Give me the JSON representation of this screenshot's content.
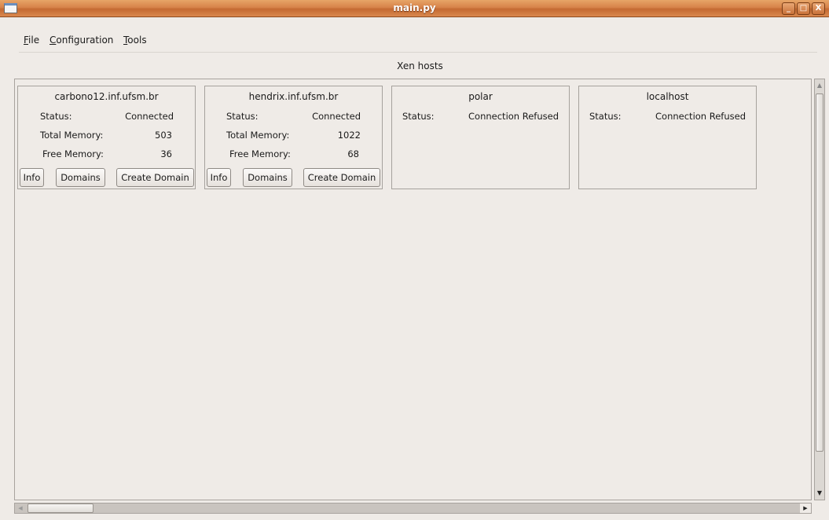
{
  "window": {
    "title": "main.py",
    "controls": {
      "minimize": "_",
      "maximize": "□",
      "close": "X"
    }
  },
  "menu": {
    "file": {
      "mnemonic": "F",
      "rest": "ile"
    },
    "configuration": {
      "mnemonic": "C",
      "rest": "onfiguration"
    },
    "tools": {
      "mnemonic": "T",
      "rest": "ools"
    }
  },
  "section_label": "Xen hosts",
  "hosts": [
    {
      "name": "carbono12.inf.ufsm.br",
      "status_label": "Status:",
      "status": "Connected",
      "total_label": "Total Memory:",
      "total": "503",
      "free_label": "Free Memory:",
      "free": "36",
      "buttons": {
        "info": "Info",
        "domains": "Domains",
        "create": "Create Domain"
      }
    },
    {
      "name": "hendrix.inf.ufsm.br",
      "status_label": "Status:",
      "status": "Connected",
      "total_label": "Total Memory:",
      "total": "1022",
      "free_label": "Free Memory:",
      "free": "68",
      "buttons": {
        "info": "Info",
        "domains": "Domains",
        "create": "Create Domain"
      }
    },
    {
      "name": "polar",
      "status_label": "Status:",
      "status": "Connection Refused"
    },
    {
      "name": "localhost",
      "status_label": "Status:",
      "status": "Connection Refused"
    }
  ],
  "scrollbars": {
    "up": "▲",
    "down": "▼",
    "left": "◀",
    "right": "▶"
  },
  "colors": {
    "titlebar": "#d7834a",
    "window_bg": "#efebe7",
    "frame_border": "#a6a29d"
  }
}
